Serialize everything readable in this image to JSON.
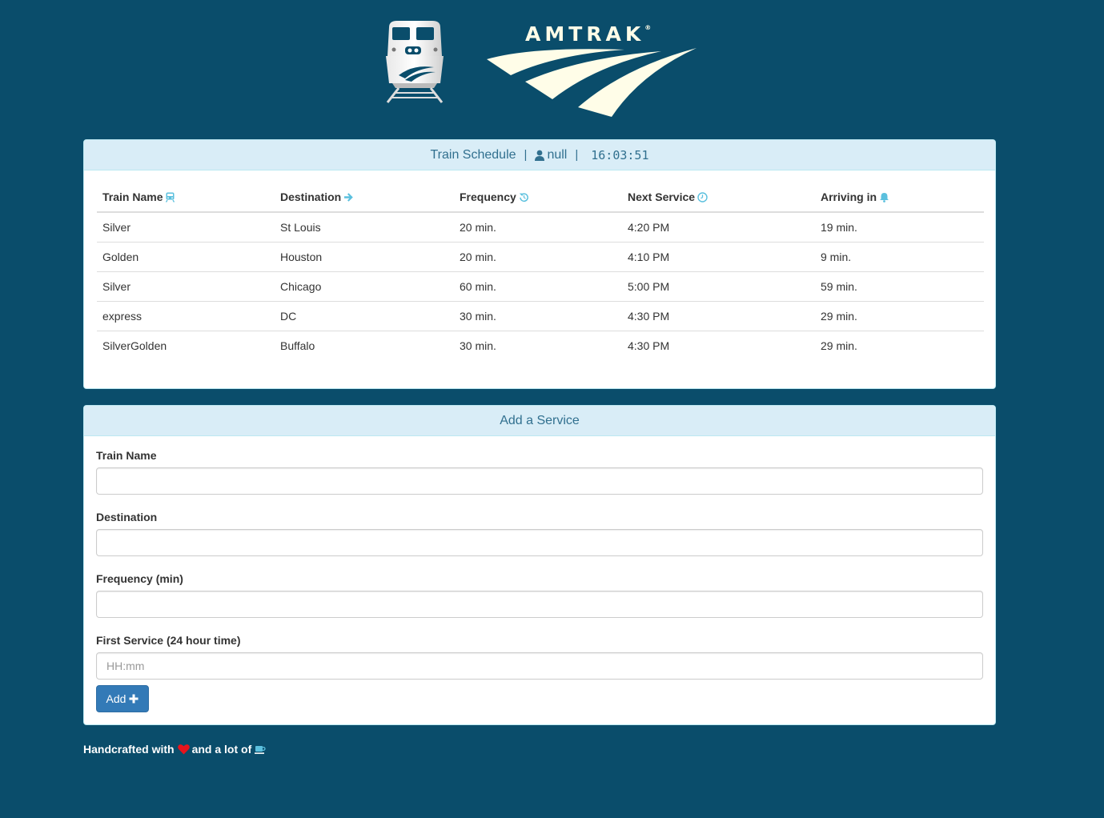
{
  "brand": {
    "logo_text": "AMTRAK",
    "registered_mark": "®"
  },
  "schedule": {
    "title": "Train Schedule",
    "separator": "|",
    "user": "null",
    "time": "16:03:51",
    "columns": [
      {
        "label": "Train Name",
        "icon": "train-icon"
      },
      {
        "label": "Destination",
        "icon": "arrow-right-icon"
      },
      {
        "label": "Frequency",
        "icon": "repeat-icon"
      },
      {
        "label": "Next Service",
        "icon": "clock-icon"
      },
      {
        "label": "Arriving in",
        "icon": "bell-icon"
      }
    ],
    "rows": [
      [
        "Silver",
        "St Louis",
        "20 min.",
        "4:20 PM",
        "19 min."
      ],
      [
        "Golden",
        "Houston",
        "20 min.",
        "4:10 PM",
        "9 min."
      ],
      [
        "Silver",
        "Chicago",
        "60 min.",
        "5:00 PM",
        "59 min."
      ],
      [
        "express",
        "DC",
        "30 min.",
        "4:30 PM",
        "29 min."
      ],
      [
        "SilverGolden",
        "Buffalo",
        "30 min.",
        "4:30 PM",
        "29 min."
      ]
    ]
  },
  "form": {
    "title": "Add a Service",
    "fields": [
      {
        "label": "Train Name",
        "value": "",
        "placeholder": ""
      },
      {
        "label": "Destination",
        "value": "",
        "placeholder": ""
      },
      {
        "label": "Frequency (min)",
        "value": "",
        "placeholder": ""
      },
      {
        "label": "First Service (24 hour time)",
        "value": "",
        "placeholder": "HH:mm"
      }
    ],
    "submit_label": "Add",
    "submit_icon": "plus-icon"
  },
  "footer": {
    "text_before": "Handcrafted with",
    "heart_icon": "heart-icon",
    "text_middle": "and a lot of",
    "cup_icon": "coffee-icon"
  },
  "colors": {
    "background": "#0a4d6b",
    "panel_heading_bg": "#d9edf7",
    "panel_heading_text": "#31708f",
    "button": "#337ab7",
    "icon_accent": "#5bc0de",
    "heart": "#e8141c"
  }
}
